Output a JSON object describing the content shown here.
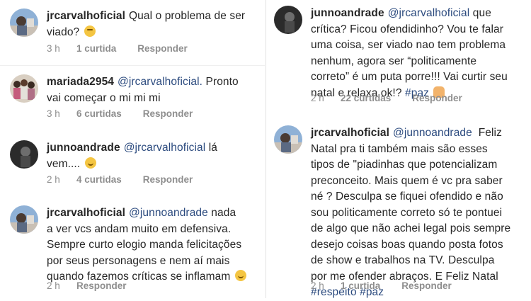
{
  "comments": [
    {
      "user": "jrcarvalhoficial",
      "pre": "",
      "text": "Qual o problema de ser viado?",
      "lines": [
        "Qual o problema de ser",
        "viado?"
      ],
      "time": "3 h",
      "likes": "1 curtida",
      "reply": "Responder",
      "emoji": "thinking-face"
    },
    {
      "user": "mariada2954",
      "mention": "@jrcarvalhoficial.",
      "lines": [
        "Pronto",
        "vai começar o mi mi mi"
      ],
      "time": "3 h",
      "likes": "6 curtidas",
      "reply": "Responder"
    },
    {
      "user": "junnoandrade",
      "mention": "@jrcarvalhoficial",
      "lines": [
        "lá",
        "vem...."
      ],
      "time": "2 h",
      "likes": "4 curtidas",
      "reply": "Responder",
      "emoji": "smiling-face"
    },
    {
      "user": "jrcarvalhoficial",
      "mention": "@junnoandrade",
      "lines": [
        "nada",
        "a ver vcs andam muito em defensiva.",
        "Sempre curto elogio manda felicitações",
        "por seus personagens e nem aí mais",
        "quando fazemos críticas se inflamam"
      ],
      "time": "2 h",
      "reply": "Responder",
      "emoji": "smiling-face"
    },
    {
      "user": "junnoandrade",
      "mention": "@jrcarvalhoficial",
      "lines": [
        "que",
        "crítica? Ficou ofendidinho? Vou te falar",
        "uma coisa, ser viado nao tem problema",
        "nenhum, agora ser “politicamente",
        "correto” é um puta porre!!! Vai curtir seu",
        "natal e relaxa ok!?"
      ],
      "hashtag": "#paz",
      "time": "2 h",
      "likes": "22 curtidas",
      "reply": "Responder",
      "emoji": "folded-hands"
    },
    {
      "user": "jrcarvalhoficial",
      "mention": "@junnoandrade",
      "lines": [
        "Feliz",
        "Natal pra ti também mais são esses",
        "tipos de \"piadinhas que potencializam",
        "preconceito. Mais quem é vc pra saber",
        "né ? Desculpa se fiquei ofendido e não",
        "sou politicamente correto só te pontuei",
        "de algo que não achei legal pois sempre",
        "desejo coisas boas quando posta fotos",
        "de show e trabalhos na TV. Desculpa",
        "por me ofender abraços. E Feliz Natal"
      ],
      "hashtags": [
        "#respeito",
        "#paz"
      ],
      "time": "2 h",
      "likes": "1 curtida",
      "reply": "Responder"
    }
  ]
}
